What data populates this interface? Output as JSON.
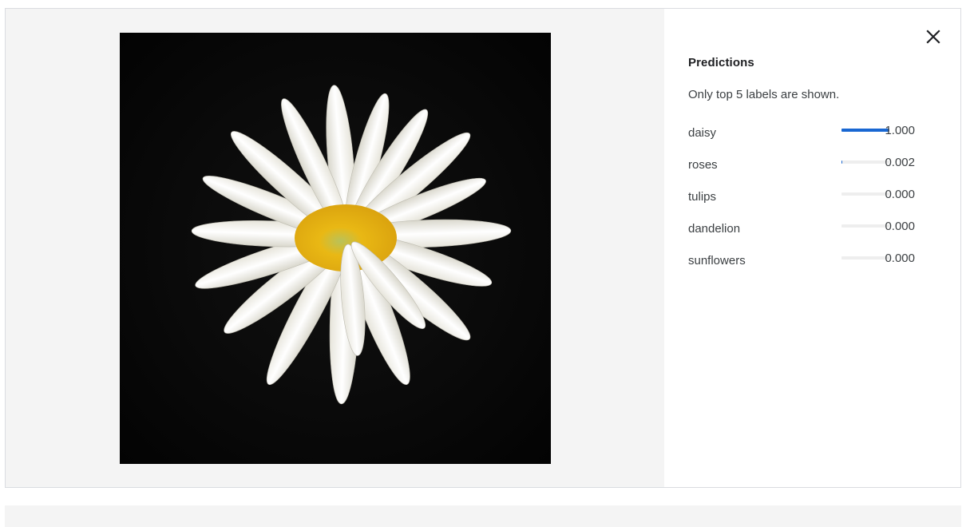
{
  "panel": {
    "title": "Predictions",
    "subtitle": "Only top 5 labels are shown."
  },
  "icons": {
    "close": "close-icon"
  },
  "colors": {
    "bar_fill": "#1967d2",
    "bar_track": "#eeeeee"
  },
  "predictions": [
    {
      "label": "daisy",
      "value": "1.000",
      "score": 1.0
    },
    {
      "label": "roses",
      "value": "0.002",
      "score": 0.002
    },
    {
      "label": "tulips",
      "value": "0.000",
      "score": 0.0
    },
    {
      "label": "dandelion",
      "value": "0.000",
      "score": 0.0
    },
    {
      "label": "sunflowers",
      "value": "0.000",
      "score": 0.0
    }
  ]
}
